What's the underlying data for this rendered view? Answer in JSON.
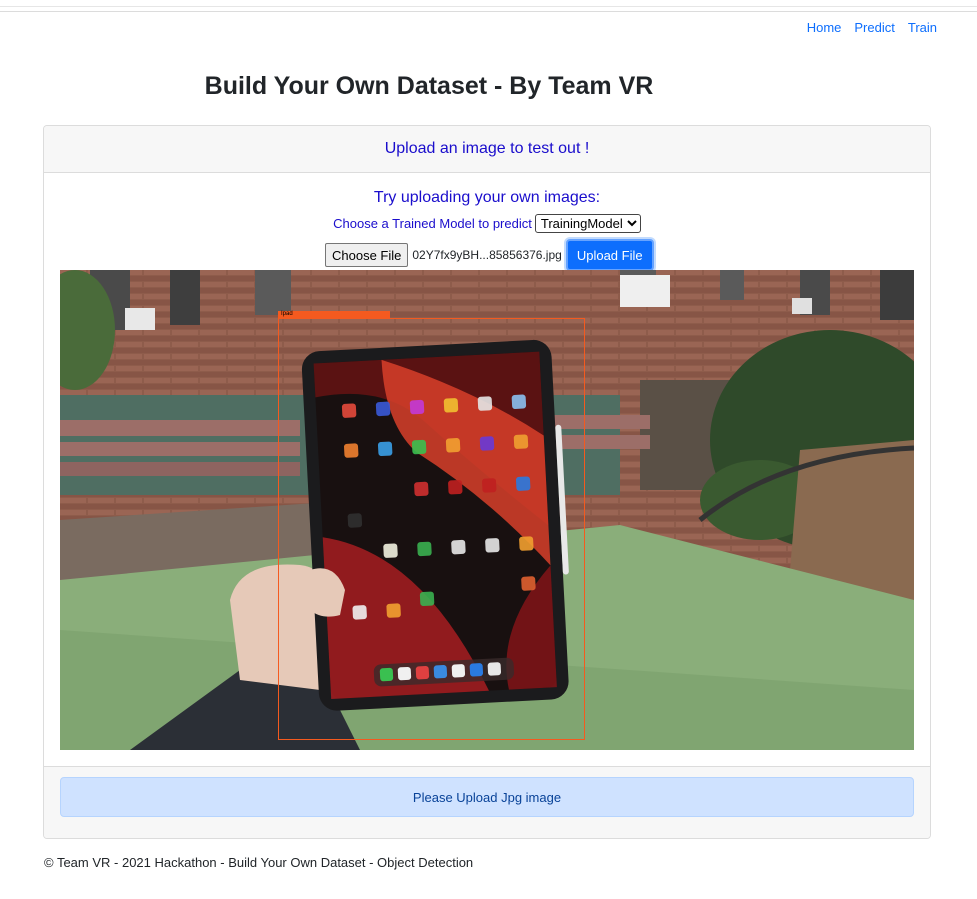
{
  "nav": {
    "home": "Home",
    "predict": "Predict",
    "train": "Train"
  },
  "page": {
    "title": "Build Your Own Dataset - By Team VR"
  },
  "card": {
    "header": "Upload an image to test out !",
    "subheading": "Try uploading your own images:",
    "model_label": "Choose a Trained Model to predict",
    "model_selected": "TrainingModel",
    "choose_file_label": "Choose File",
    "file_name": "02Y7fx9yBH...85856376.jpg",
    "upload_label": "Upload File",
    "detection_label": "Ipad",
    "alert": "Please Upload Jpg image"
  },
  "footer": {
    "text": "© Team VR - 2021 Hackathon - Build Your Own Dataset - Object Detection"
  },
  "colors": {
    "accent": "#0d6efd",
    "heading_blue": "#1a0dcc",
    "detection": "#f45a1f",
    "alert_bg": "#cfe2ff"
  }
}
